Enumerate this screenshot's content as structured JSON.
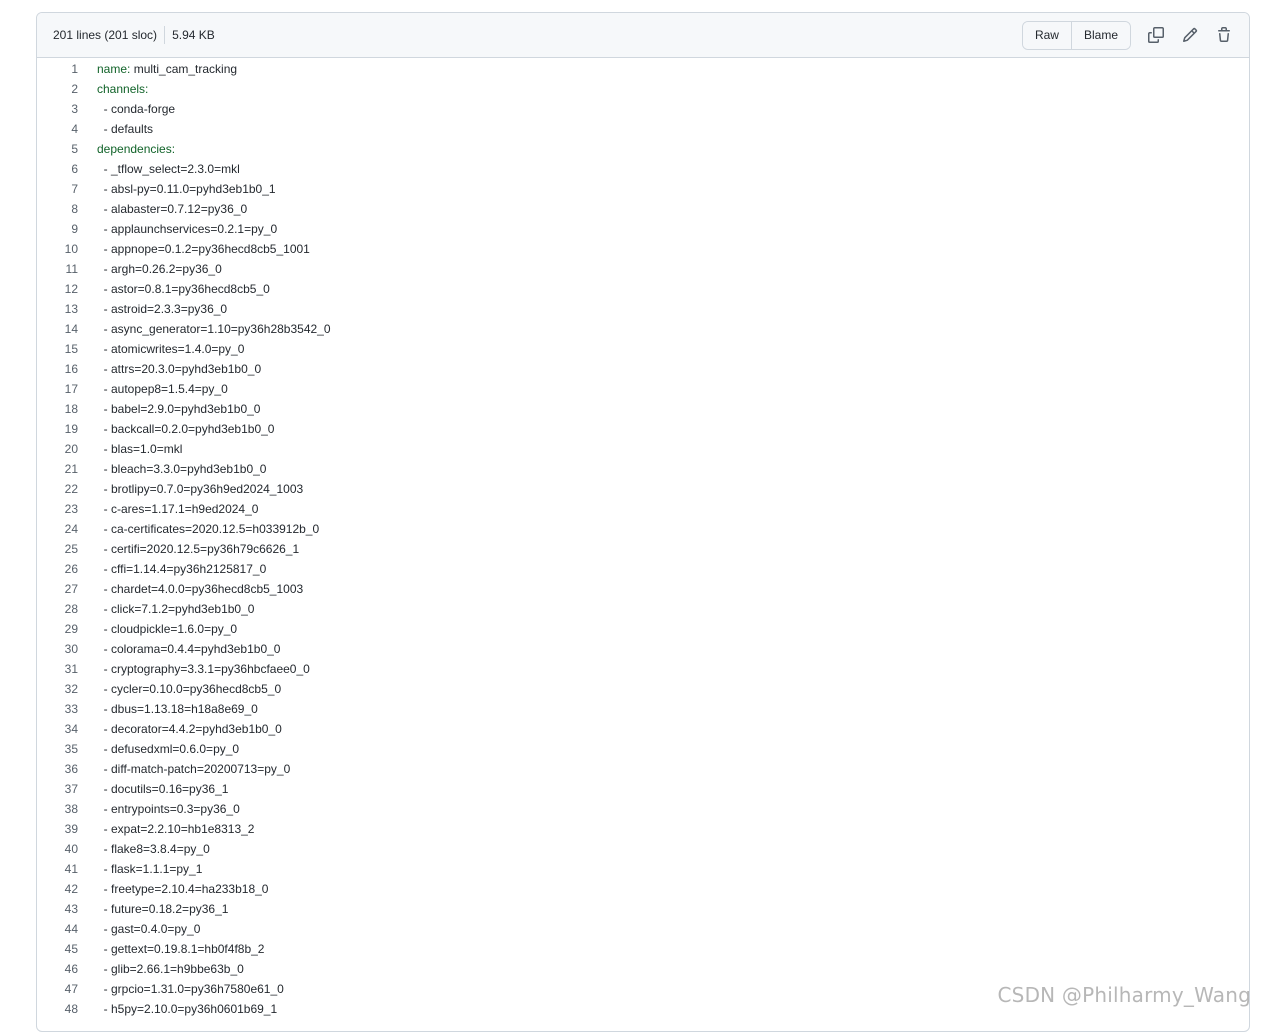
{
  "file_header": {
    "lines_info": "201 lines (201 sloc)",
    "size": "5.94 KB",
    "raw_label": "Raw",
    "blame_label": "Blame"
  },
  "code_lines": [
    {
      "n": "1",
      "key": "name:",
      "val": " multi_cam_tracking"
    },
    {
      "n": "2",
      "key": "channels:",
      "val": ""
    },
    {
      "n": "3",
      "key": "",
      "val": "  - conda-forge"
    },
    {
      "n": "4",
      "key": "",
      "val": "  - defaults"
    },
    {
      "n": "5",
      "key": "dependencies:",
      "val": ""
    },
    {
      "n": "6",
      "key": "",
      "val": "  - _tflow_select=2.3.0=mkl"
    },
    {
      "n": "7",
      "key": "",
      "val": "  - absl-py=0.11.0=pyhd3eb1b0_1"
    },
    {
      "n": "8",
      "key": "",
      "val": "  - alabaster=0.7.12=py36_0"
    },
    {
      "n": "9",
      "key": "",
      "val": "  - applaunchservices=0.2.1=py_0"
    },
    {
      "n": "10",
      "key": "",
      "val": "  - appnope=0.1.2=py36hecd8cb5_1001"
    },
    {
      "n": "11",
      "key": "",
      "val": "  - argh=0.26.2=py36_0"
    },
    {
      "n": "12",
      "key": "",
      "val": "  - astor=0.8.1=py36hecd8cb5_0"
    },
    {
      "n": "13",
      "key": "",
      "val": "  - astroid=2.3.3=py36_0"
    },
    {
      "n": "14",
      "key": "",
      "val": "  - async_generator=1.10=py36h28b3542_0"
    },
    {
      "n": "15",
      "key": "",
      "val": "  - atomicwrites=1.4.0=py_0"
    },
    {
      "n": "16",
      "key": "",
      "val": "  - attrs=20.3.0=pyhd3eb1b0_0"
    },
    {
      "n": "17",
      "key": "",
      "val": "  - autopep8=1.5.4=py_0"
    },
    {
      "n": "18",
      "key": "",
      "val": "  - babel=2.9.0=pyhd3eb1b0_0"
    },
    {
      "n": "19",
      "key": "",
      "val": "  - backcall=0.2.0=pyhd3eb1b0_0"
    },
    {
      "n": "20",
      "key": "",
      "val": "  - blas=1.0=mkl"
    },
    {
      "n": "21",
      "key": "",
      "val": "  - bleach=3.3.0=pyhd3eb1b0_0"
    },
    {
      "n": "22",
      "key": "",
      "val": "  - brotlipy=0.7.0=py36h9ed2024_1003"
    },
    {
      "n": "23",
      "key": "",
      "val": "  - c-ares=1.17.1=h9ed2024_0"
    },
    {
      "n": "24",
      "key": "",
      "val": "  - ca-certificates=2020.12.5=h033912b_0"
    },
    {
      "n": "25",
      "key": "",
      "val": "  - certifi=2020.12.5=py36h79c6626_1"
    },
    {
      "n": "26",
      "key": "",
      "val": "  - cffi=1.14.4=py36h2125817_0"
    },
    {
      "n": "27",
      "key": "",
      "val": "  - chardet=4.0.0=py36hecd8cb5_1003"
    },
    {
      "n": "28",
      "key": "",
      "val": "  - click=7.1.2=pyhd3eb1b0_0"
    },
    {
      "n": "29",
      "key": "",
      "val": "  - cloudpickle=1.6.0=py_0"
    },
    {
      "n": "30",
      "key": "",
      "val": "  - colorama=0.4.4=pyhd3eb1b0_0"
    },
    {
      "n": "31",
      "key": "",
      "val": "  - cryptography=3.3.1=py36hbcfaee0_0"
    },
    {
      "n": "32",
      "key": "",
      "val": "  - cycler=0.10.0=py36hecd8cb5_0"
    },
    {
      "n": "33",
      "key": "",
      "val": "  - dbus=1.13.18=h18a8e69_0"
    },
    {
      "n": "34",
      "key": "",
      "val": "  - decorator=4.4.2=pyhd3eb1b0_0"
    },
    {
      "n": "35",
      "key": "",
      "val": "  - defusedxml=0.6.0=py_0"
    },
    {
      "n": "36",
      "key": "",
      "val": "  - diff-match-patch=20200713=py_0"
    },
    {
      "n": "37",
      "key": "",
      "val": "  - docutils=0.16=py36_1"
    },
    {
      "n": "38",
      "key": "",
      "val": "  - entrypoints=0.3=py36_0"
    },
    {
      "n": "39",
      "key": "",
      "val": "  - expat=2.2.10=hb1e8313_2"
    },
    {
      "n": "40",
      "key": "",
      "val": "  - flake8=3.8.4=py_0"
    },
    {
      "n": "41",
      "key": "",
      "val": "  - flask=1.1.1=py_1"
    },
    {
      "n": "42",
      "key": "",
      "val": "  - freetype=2.10.4=ha233b18_0"
    },
    {
      "n": "43",
      "key": "",
      "val": "  - future=0.18.2=py36_1"
    },
    {
      "n": "44",
      "key": "",
      "val": "  - gast=0.4.0=py_0"
    },
    {
      "n": "45",
      "key": "",
      "val": "  - gettext=0.19.8.1=hb0f4f8b_2"
    },
    {
      "n": "46",
      "key": "",
      "val": "  - glib=2.66.1=h9bbe63b_0"
    },
    {
      "n": "47",
      "key": "",
      "val": "  - grpcio=1.31.0=py36h7580e61_0"
    },
    {
      "n": "48",
      "key": "",
      "val": "  - h5py=2.10.0=py36h0601b69_1"
    }
  ],
  "watermark": "CSDN @Philharmy_Wang",
  "icons": {
    "copy": "copy-icon",
    "edit": "pencil-icon",
    "delete": "trash-icon"
  }
}
